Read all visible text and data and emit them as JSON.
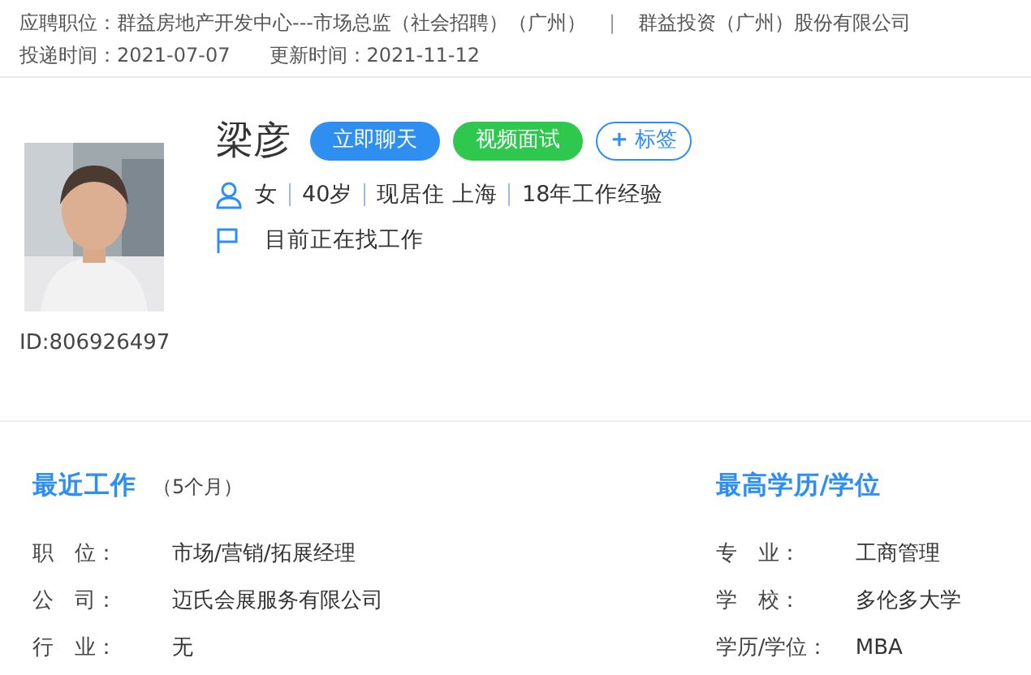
{
  "application": {
    "position_label": "应聘职位：",
    "position": "群益房地产开发中心---市场总监（社会招聘）（广州）",
    "separator": "|",
    "company": "群益投资（广州）股份有限公司",
    "sent_label": "投递时间：",
    "sent": "2021-07-07",
    "updated_label": "更新时间：",
    "updated": "2021-11-12"
  },
  "profile": {
    "id": "ID:806926497",
    "name": "梁彦",
    "buttons": [
      {
        "label": "立即聊天",
        "kind": "chat"
      },
      {
        "label": "视频面试",
        "kind": "video"
      },
      {
        "label": "标签",
        "kind": "tag",
        "icon": "+"
      }
    ],
    "facts": [
      "女",
      "40岁",
      "现居住 上海",
      "18年工作经验"
    ],
    "status": "目前正在找工作"
  },
  "recent_work": {
    "title": "最近工作",
    "duration": "（5个月）",
    "fields": [
      {
        "label": "职　位：",
        "value": "市场/营销/拓展经理"
      },
      {
        "label": "公　司：",
        "value": "迈氏会展服务有限公司"
      },
      {
        "label": "行　业：",
        "value": "无"
      }
    ]
  },
  "education": {
    "title": "最高学历/学位",
    "fields": [
      {
        "label": "专　业：",
        "value": "工商管理"
      },
      {
        "label": "学　校：",
        "value": "多伦多大学"
      },
      {
        "label": "学历/学位：",
        "value": "MBA"
      }
    ]
  }
}
